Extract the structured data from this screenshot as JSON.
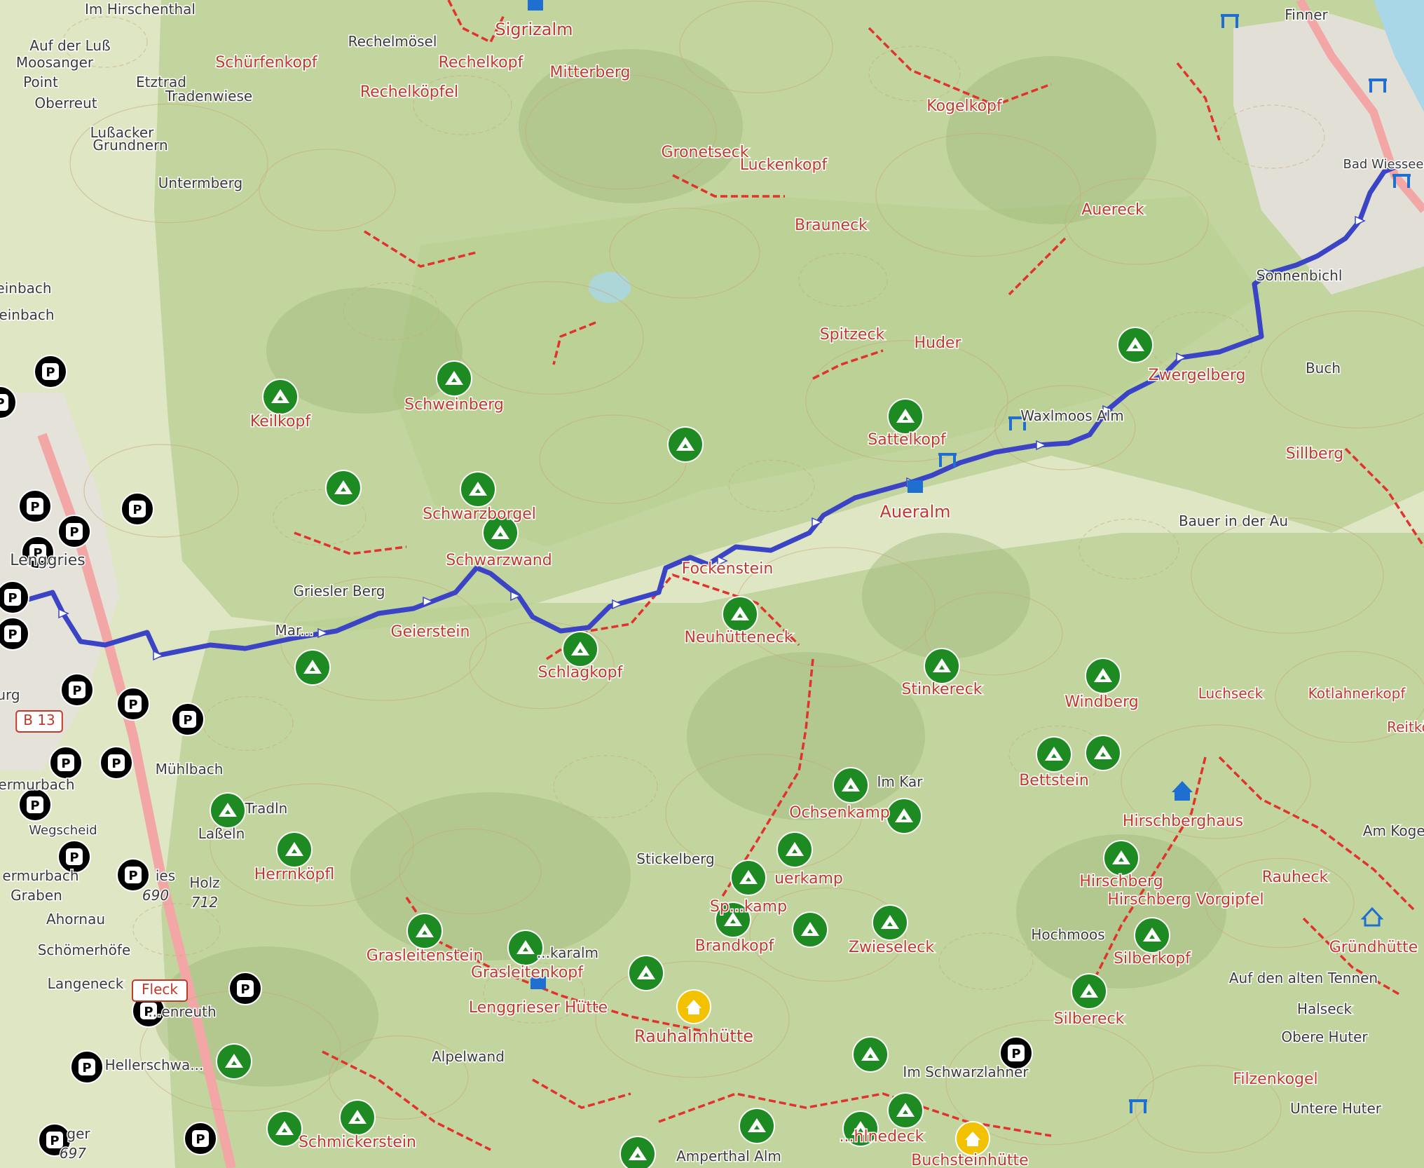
{
  "map": {
    "colors": {
      "terrain_light": "#dfe6c4",
      "terrain_green": "#b9cf92",
      "terrain_dark": "#9fb97a",
      "contour": "#c9a77a",
      "trail_red": "#e2322d",
      "route": "#3b44c4",
      "town": "#e6e1dc",
      "road": "#f3a6a6",
      "water": "#a9d7e8",
      "peak_green": "#1d8a22",
      "hut_yellow": "#f2c200",
      "parking": "#000000",
      "label_red": "#c0392b",
      "label_dark": "#3b3b3b",
      "transport_blue": "#1e6fd0"
    },
    "labels": [
      {
        "id": "im-hirschenthal",
        "text": "Im Hirschenthal",
        "style": "dark"
      },
      {
        "id": "sigrizalm",
        "text": "Sigrizalm",
        "style": "red"
      },
      {
        "id": "finner",
        "text": "Finner",
        "style": "dark"
      },
      {
        "id": "auf-der-luss",
        "text": "Auf der Luß",
        "style": "dark"
      },
      {
        "id": "rechelmoesel",
        "text": "Rechelmösel",
        "style": "dark"
      },
      {
        "id": "moosanger",
        "text": "Moosanger",
        "style": "dark"
      },
      {
        "id": "schuerfenkopf",
        "text": "Schürfenkopf",
        "style": "red"
      },
      {
        "id": "rechelkopf",
        "text": "Rechelkopf",
        "style": "red"
      },
      {
        "id": "point",
        "text": "Point",
        "style": "dark"
      },
      {
        "id": "etztrad",
        "text": "Etztrad",
        "style": "dark"
      },
      {
        "id": "mitterberg",
        "text": "Mitterberg",
        "style": "red"
      },
      {
        "id": "tradenwiese",
        "text": "Tradenwiese",
        "style": "dark"
      },
      {
        "id": "rechelkoepfel",
        "text": "Rechelköpfel",
        "style": "red"
      },
      {
        "id": "oberreut",
        "text": "Oberreut",
        "style": "dark"
      },
      {
        "id": "kogelkopf",
        "text": "Kogelkopf",
        "style": "red"
      },
      {
        "id": "lussacker",
        "text": "Lußacker",
        "style": "dark"
      },
      {
        "id": "grundnern",
        "text": "Grundnern",
        "style": "dark"
      },
      {
        "id": "gronetseck",
        "text": "Gronetseck",
        "style": "red"
      },
      {
        "id": "luckenkopf",
        "text": "Luckenkopf",
        "style": "red"
      },
      {
        "id": "bad-wiessee",
        "text": "Bad Wiessee",
        "style": "dark"
      },
      {
        "id": "untermberg",
        "text": "Untermberg",
        "style": "dark"
      },
      {
        "id": "aueregg",
        "text": "Auereck",
        "style": "red"
      },
      {
        "id": "brauneck",
        "text": "Brauneck",
        "style": "red"
      },
      {
        "id": "einbach1",
        "text": "einbach",
        "style": "dark"
      },
      {
        "id": "einbach2",
        "text": "einbach",
        "style": "dark"
      },
      {
        "id": "sonnenbichl",
        "text": "Sonnenbichl",
        "style": "dark"
      },
      {
        "id": "spitzeck",
        "text": "Spitzeck",
        "style": "red"
      },
      {
        "id": "huder",
        "text": "Huder",
        "style": "red"
      },
      {
        "id": "buch",
        "text": "Buch",
        "style": "dark"
      },
      {
        "id": "keilkopf",
        "text": "Keilkopf",
        "style": "red"
      },
      {
        "id": "schweinberg",
        "text": "Schweinberg",
        "style": "red"
      },
      {
        "id": "zwergelberg",
        "text": "Zwergelberg",
        "style": "red"
      },
      {
        "id": "waxlmoos-alm",
        "text": "Waxlmoos Alm",
        "style": "dark"
      },
      {
        "id": "sattelkopf",
        "text": "Sattelkopf",
        "style": "red"
      },
      {
        "id": "sillberg",
        "text": "Sillberg",
        "style": "red"
      },
      {
        "id": "schwarzborgel",
        "text": "Schwarzborgel",
        "style": "red"
      },
      {
        "id": "aueralm",
        "text": "Aueralm",
        "style": "red"
      },
      {
        "id": "bauer-in-der-au",
        "text": "Bauer in der Au",
        "style": "dark"
      },
      {
        "id": "lenggries",
        "text": "Lenggries",
        "style": "dark"
      },
      {
        "id": "schwarzwand",
        "text": "Schwarzwand",
        "style": "red"
      },
      {
        "id": "fockenstein",
        "text": "Fockenstein",
        "style": "red"
      },
      {
        "id": "griesler-berg",
        "text": "Griesler Berg",
        "style": "dark"
      },
      {
        "id": "geierstein",
        "text": "Geierstein",
        "style": "red"
      },
      {
        "id": "neuhuetteneck",
        "text": "Neuhütteneck",
        "style": "red"
      },
      {
        "id": "schlagkopf",
        "text": "Schlagkopf",
        "style": "red"
      },
      {
        "id": "stinkereck",
        "text": "Stinkereck",
        "style": "red"
      },
      {
        "id": "windberg",
        "text": "Windberg",
        "style": "red"
      },
      {
        "id": "luchseck",
        "text": "Luchseck",
        "style": "red"
      },
      {
        "id": "kotlahnerkopf",
        "text": "Kotlahnerkopf",
        "style": "red"
      },
      {
        "id": "reitkopf",
        "text": "Reitkö",
        "style": "red"
      },
      {
        "id": "b13",
        "text": "B 13",
        "style": "shield"
      },
      {
        "id": "burg",
        "text": "urg",
        "style": "dark"
      },
      {
        "id": "muehlbach",
        "text": "Mühlbach",
        "style": "dark"
      },
      {
        "id": "bettstein",
        "text": "Bettstein",
        "style": "red"
      },
      {
        "id": "hirschberghaus",
        "text": "Hirschberghaus",
        "style": "red"
      },
      {
        "id": "ermurbach",
        "text": "ermurbach",
        "style": "dark"
      },
      {
        "id": "im-kar",
        "text": "Im Kar",
        "style": "dark"
      },
      {
        "id": "ochsenkamp",
        "text": "Ochsenkamp",
        "style": "red"
      },
      {
        "id": "tradln",
        "text": "Tradln",
        "style": "dark"
      },
      {
        "id": "lasseln",
        "text": "Laßeln",
        "style": "dark"
      },
      {
        "id": "am-kogel",
        "text": "Am Kogel",
        "style": "dark"
      },
      {
        "id": "wegscheid",
        "text": "Wegscheid",
        "style": "dark"
      },
      {
        "id": "herrnkoepfl",
        "text": "Herrnköpfl",
        "style": "red"
      },
      {
        "id": "stickelberg",
        "text": "Stickelberg",
        "style": "dark"
      },
      {
        "id": "hirschberg",
        "text": "Hirschberg",
        "style": "red"
      },
      {
        "id": "rauheck",
        "text": "Rauheck",
        "style": "red"
      },
      {
        "id": "lauerkamp",
        "text": "uerkamp",
        "style": "red"
      },
      {
        "id": "ermurbach2",
        "text": "ermurbach",
        "style": "dark"
      },
      {
        "id": "hirschberg-vorgipfel",
        "text": "Hirschberg Vorgipfel",
        "style": "red"
      },
      {
        "id": "wies",
        "text": "ies",
        "style": "dark"
      },
      {
        "id": "holz",
        "text": "Holz",
        "style": "dark"
      },
      {
        "id": "graben",
        "text": "Graben",
        "style": "dark"
      },
      {
        "id": "ele-690",
        "text": "690",
        "style": "ele"
      },
      {
        "id": "ele-712",
        "text": "712",
        "style": "ele"
      },
      {
        "id": "sonnkamp",
        "text": "Sp...kamp",
        "style": "red"
      },
      {
        "id": "ahornau",
        "text": "Ahornau",
        "style": "dark"
      },
      {
        "id": "hochmoos",
        "text": "Hochmoos",
        "style": "dark"
      },
      {
        "id": "gruendhuette",
        "text": "Gründhütte",
        "style": "red"
      },
      {
        "id": "brandkopf",
        "text": "Brandkopf",
        "style": "red"
      },
      {
        "id": "zwieseleck",
        "text": "Zwieseleck",
        "style": "red"
      },
      {
        "id": "silberkopf",
        "text": "Silberkopf",
        "style": "red"
      },
      {
        "id": "schoemerhoefe",
        "text": "Schömerhöfe",
        "style": "dark"
      },
      {
        "id": "grasleitenstein",
        "text": "Grasleitenstein",
        "style": "red"
      },
      {
        "id": "karalm",
        "text": "...karalm",
        "style": "dark"
      },
      {
        "id": "grasleitenkopf",
        "text": "Grasleitenkopf",
        "style": "red"
      },
      {
        "id": "auf-den-alten-tennen",
        "text": "Auf den alten Tennen",
        "style": "dark"
      },
      {
        "id": "langeneck",
        "text": "Langeneck",
        "style": "dark"
      },
      {
        "id": "fleck",
        "text": "Fleck",
        "style": "boxed"
      },
      {
        "id": "lenggrieser-huette",
        "text": "Lenggrieser Hütte",
        "style": "red"
      },
      {
        "id": "halseck",
        "text": "Halseck",
        "style": "dark"
      },
      {
        "id": "renreuth",
        "text": "...enreuth",
        "style": "dark"
      },
      {
        "id": "rauhalmhuette",
        "text": "Rauhalmhütte",
        "style": "red"
      },
      {
        "id": "silbereck",
        "text": "Silbereck",
        "style": "red"
      },
      {
        "id": "obere-huter",
        "text": "Obere Huter",
        "style": "dark"
      },
      {
        "id": "alpelwand",
        "text": "Alpelwand",
        "style": "dark"
      },
      {
        "id": "hellerschwang",
        "text": "Hellerschwa...",
        "style": "dark"
      },
      {
        "id": "im-schwarzlahner",
        "text": "Im Schwarzlahner",
        "style": "dark"
      },
      {
        "id": "filzenkogel",
        "text": "Filzenkogel",
        "style": "red"
      },
      {
        "id": "untere-huter",
        "text": "Untere Huter",
        "style": "dark"
      },
      {
        "id": "schmickerstein",
        "text": "Schmickerstein",
        "style": "red"
      },
      {
        "id": "hahlnedeck",
        "text": "...hlnedeck",
        "style": "red"
      },
      {
        "id": "ger",
        "text": "ger",
        "style": "dark"
      },
      {
        "id": "ele-697",
        "text": "697",
        "style": "ele"
      },
      {
        "id": "amperthal-alm",
        "text": "Amperthal Alm",
        "style": "dark"
      },
      {
        "id": "buchsteinhuette",
        "text": "Buchsteinhütte",
        "style": "red"
      },
      {
        "id": "marbach",
        "text": "Mar...",
        "style": "dark"
      }
    ]
  }
}
